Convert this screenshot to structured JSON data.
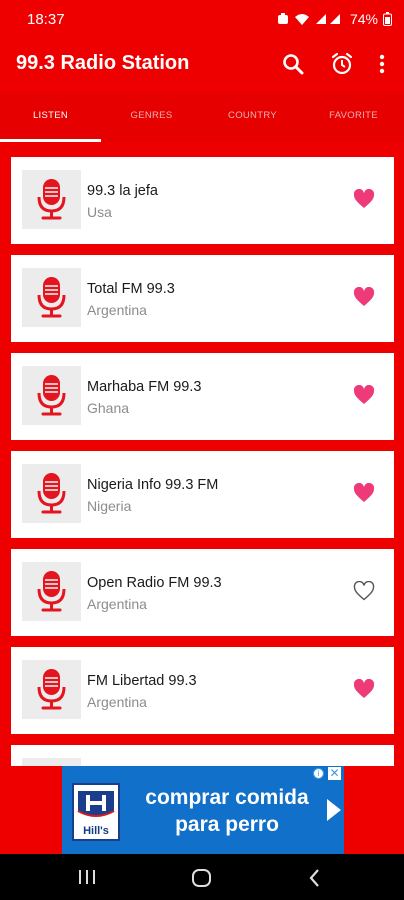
{
  "status": {
    "time": "18:37",
    "battery": "74%"
  },
  "app": {
    "title": "99.3 Radio Station"
  },
  "tabs": [
    {
      "label": "LISTEN",
      "active": true
    },
    {
      "label": "GENRES",
      "active": false
    },
    {
      "label": "COUNTRY",
      "active": false
    },
    {
      "label": "FAVORITE",
      "active": false
    }
  ],
  "stations": [
    {
      "name": "99.3 la jefa",
      "country": "Usa",
      "favorite": true
    },
    {
      "name": "Total FM 99.3",
      "country": "Argentina",
      "favorite": true
    },
    {
      "name": "Marhaba FM 99.3",
      "country": "Ghana",
      "favorite": true
    },
    {
      "name": "Nigeria Info 99.3 FM",
      "country": "Nigeria",
      "favorite": true
    },
    {
      "name": "Open Radio FM 99.3",
      "country": "Argentina",
      "favorite": false
    },
    {
      "name": "FM Libertad 99.3",
      "country": "Argentina",
      "favorite": true
    }
  ],
  "ad": {
    "brand": "Hill's",
    "text_line1": "comprar comida",
    "text_line2": "para perro"
  },
  "colors": {
    "primary": "#ee0000",
    "heart": "#ee3a78",
    "ad_bg": "#1170c9"
  },
  "icons": {
    "search": "search-icon",
    "alarm": "alarm-icon",
    "menu": "more-vert-icon",
    "station": "microphone-icon",
    "favorite": "heart-icon"
  }
}
